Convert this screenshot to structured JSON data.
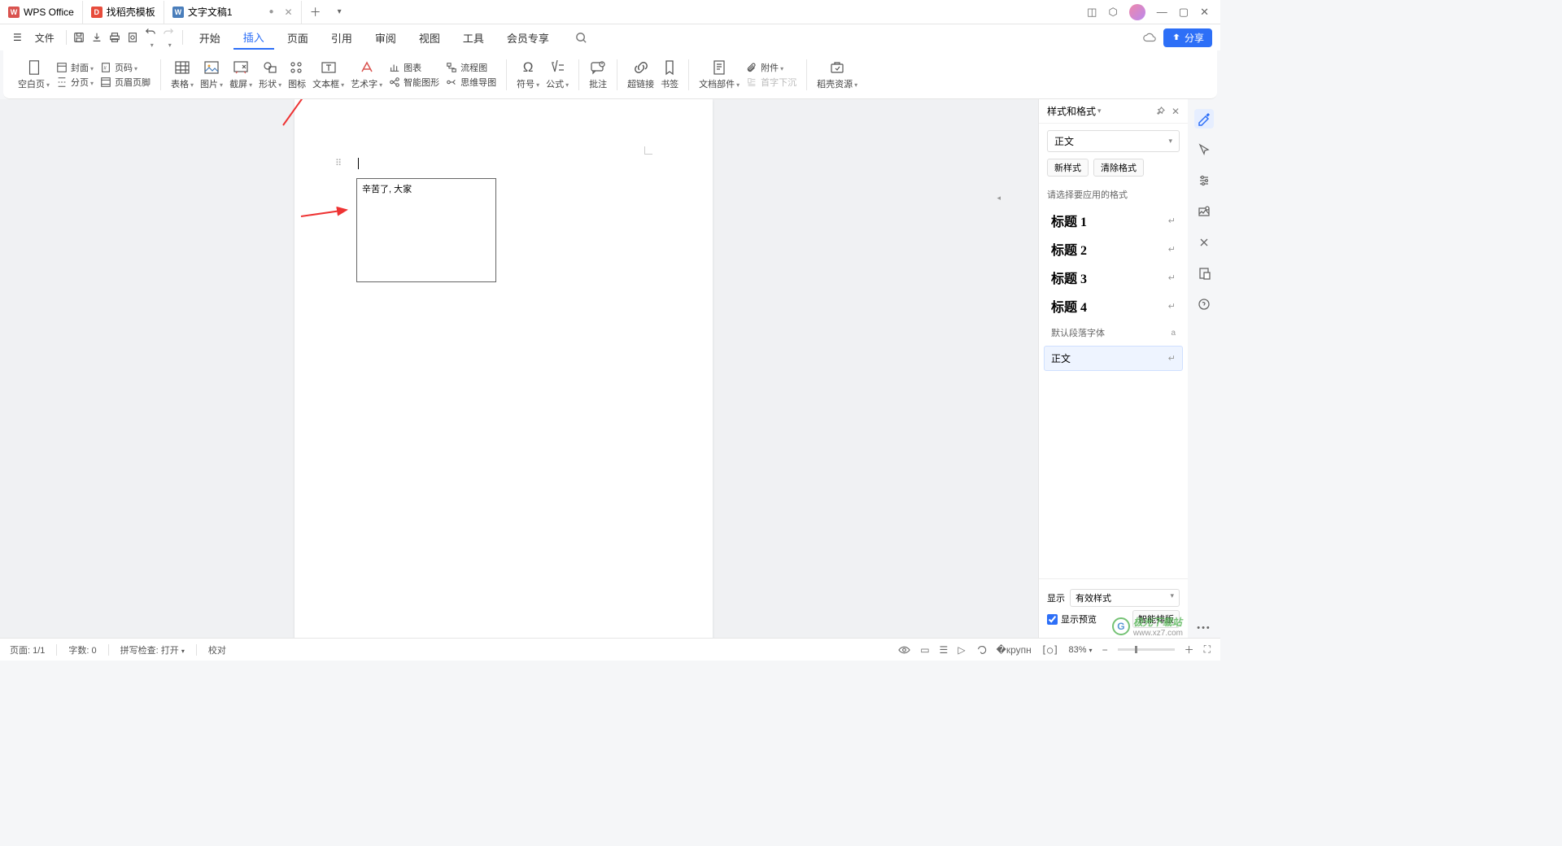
{
  "tabs": {
    "wps": "WPS Office",
    "template": "找稻壳模板",
    "doc": "文字文稿1"
  },
  "menu": {
    "file": "文件",
    "start": "开始",
    "insert": "插入",
    "page": "页面",
    "ref": "引用",
    "review": "审阅",
    "view": "视图",
    "tools": "工具",
    "member": "会员专享"
  },
  "share": "分享",
  "ribbon": {
    "blank_page": "空白页",
    "cover": "封面",
    "page_number": "页码",
    "page_break": "分页",
    "header_footer": "页眉页脚",
    "table": "表格",
    "picture": "图片",
    "screenshot": "截屏",
    "shape": "形状",
    "icon": "图标",
    "textbox": "文本框",
    "wordart": "艺术字",
    "chart": "图表",
    "smart_graphic": "智能图形",
    "mindmap": "思维导图",
    "symbol": "符号",
    "equation": "公式",
    "comment": "批注",
    "hyperlink": "超链接",
    "bookmark": "书签",
    "doc_parts": "文档部件",
    "attachment": "附件",
    "drop_cap": "首字下沉",
    "daoke_resource": "稻壳资源"
  },
  "document": {
    "textbox_content": "辛苦了, 大家"
  },
  "panel": {
    "title": "样式和格式",
    "current_style": "正文",
    "new_style": "新样式",
    "clear_format": "清除格式",
    "hint": "请选择要应用的格式",
    "styles": {
      "h1": "标题 1",
      "h2": "标题 2",
      "h3": "标题 3",
      "h4": "标题 4",
      "default_para": "默认段落字体",
      "body": "正文"
    },
    "display_label": "显示",
    "display_value": "有效样式",
    "preview_checkbox": "显示预览",
    "smart_layout": "智能排版"
  },
  "statusbar": {
    "page": "页面: 1/1",
    "words": "字数: 0",
    "spell": "拼写检查: 打开",
    "proof": "校对",
    "zoom": "83%"
  },
  "watermark": {
    "text1": "极光下载站",
    "text2": "www.xz7.com"
  }
}
